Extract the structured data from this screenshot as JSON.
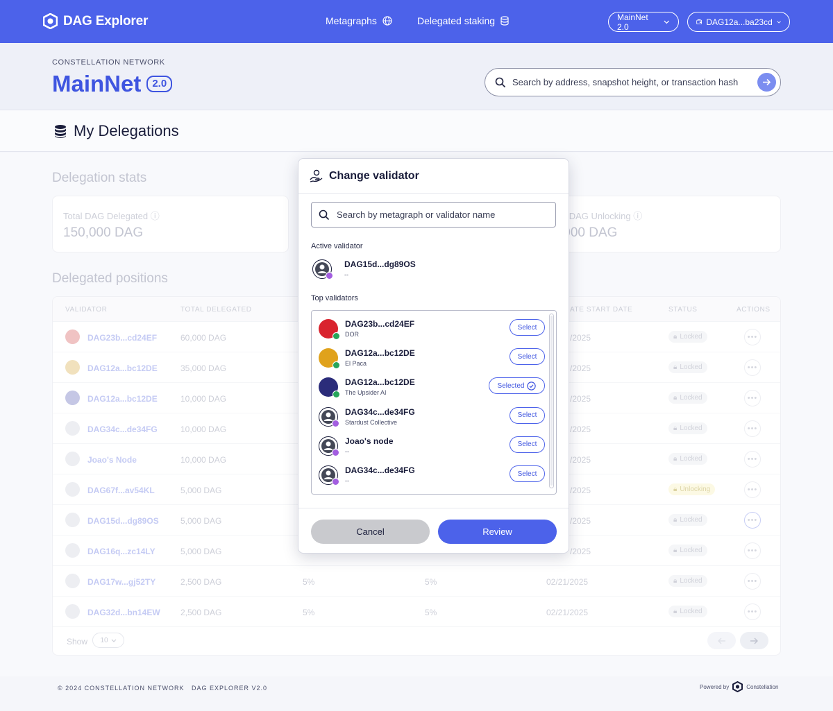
{
  "topbar": {
    "logo_text": "DAG Explorer",
    "nav": [
      {
        "label": "Metagraphs",
        "icon": "globe-icon"
      },
      {
        "label": "Delegated staking",
        "icon": "database-icon"
      }
    ],
    "network_label": "MainNet 2.0",
    "wallet_label": "DAG12a...ba23cd"
  },
  "hero": {
    "eyebrow": "CONSTELLATION NETWORK",
    "title": "MainNet",
    "badge": "2.0",
    "search_placeholder": "Search by address, snapshot height, or transaction hash"
  },
  "page_title": "My Delegations",
  "stats": {
    "heading": "Delegation stats",
    "cards": [
      {
        "label": "Total DAG Delegated",
        "value": "150,000 DAG"
      },
      {
        "label": "al DAG Unlocking",
        "value": ",000 DAG"
      }
    ]
  },
  "positions": {
    "heading": "Delegated positions",
    "columns": [
      "VALIDATOR",
      "TOTAL DELEGATED",
      "ATE START DATE",
      "STATUS",
      "ACTIONS"
    ],
    "rows": [
      {
        "validator": "DAG23b...cd24EF",
        "total": "60,000 DAG",
        "c3": "",
        "c4": "",
        "date": "/2025",
        "status": "Locked",
        "avatar": "#e8a3a3"
      },
      {
        "validator": "DAG12a...bc12DE",
        "total": "35,000 DAG",
        "c3": "",
        "c4": "",
        "date": "/2025",
        "status": "Locked",
        "avatar": "#ead29a"
      },
      {
        "validator": "DAG12a...bc12DE",
        "total": "10,000 DAG",
        "c3": "",
        "c4": "",
        "date": "/2025",
        "status": "Locked",
        "avatar": "#a7a9d8"
      },
      {
        "validator": "DAG34c...de34FG",
        "total": "10,000 DAG",
        "c3": "",
        "c4": "",
        "date": "/2025",
        "status": "Locked",
        "avatar": "#e3e5ec"
      },
      {
        "validator": "Joao's Node",
        "total": "10,000 DAG",
        "c3": "",
        "c4": "",
        "date": "/2025",
        "status": "Locked",
        "avatar": "#e3e5ec"
      },
      {
        "validator": "DAG67f...av54KL",
        "total": "5,000 DAG",
        "c3": "",
        "c4": "",
        "date": "/2025",
        "status": "Unlocking",
        "avatar": "#e3e5ec"
      },
      {
        "validator": "DAG15d...dg89OS",
        "total": "5,000 DAG",
        "c3": "",
        "c4": "",
        "date": "/2025",
        "status": "Locked",
        "avatar": "#e3e5ec"
      },
      {
        "validator": "DAG16q...zc14LY",
        "total": "5,000 DAG",
        "c3": "",
        "c4": "",
        "date": "/2025",
        "status": "Locked",
        "avatar": "#e3e5ec"
      },
      {
        "validator": "DAG17w...gj52TY",
        "total": "2,500 DAG",
        "c3": "5%",
        "c4": "5%",
        "date": "02/21/2025",
        "status": "Locked",
        "avatar": "#e3e5ec"
      },
      {
        "validator": "DAG32d...bn14EW",
        "total": "2,500 DAG",
        "c3": "5%",
        "c4": "5%",
        "date": "02/21/2025",
        "status": "Locked",
        "avatar": "#e3e5ec"
      }
    ],
    "show_label": "Show",
    "page_size": "10"
  },
  "modal": {
    "title": "Change validator",
    "search_placeholder": "Search by metagraph or validator name",
    "active_label": "Active validator",
    "active": {
      "name": "DAG15d...dg89OS",
      "sub": "--"
    },
    "top_label": "Top validators",
    "validators": [
      {
        "name": "DAG23b...cd24EF",
        "sub": "DOR",
        "button": "Select",
        "selected": false,
        "avatar": "#d9232e"
      },
      {
        "name": "DAG12a...bc12DE",
        "sub": "El Paca",
        "button": "Select",
        "selected": false,
        "avatar": "#e0a21c"
      },
      {
        "name": "DAG12a...bc12DE",
        "sub": "The Upsider AI",
        "button": "Selected",
        "selected": true,
        "avatar": "#2b2c7a"
      },
      {
        "name": "DAG34c...de34FG",
        "sub": "Stardust Collective",
        "button": "Select",
        "selected": false,
        "avatar": "#ffffff"
      },
      {
        "name": "Joao's node",
        "sub": "--",
        "button": "Select",
        "selected": false,
        "avatar": "#ffffff"
      },
      {
        "name": "DAG34c...de34FG",
        "sub": "--",
        "button": "Select",
        "selected": false,
        "avatar": "#ffffff"
      }
    ],
    "cancel_label": "Cancel",
    "review_label": "Review"
  },
  "footer": {
    "copyright": "© 2024 CONSTELLATION NETWORK",
    "version": "DAG EXPLORER V2.0",
    "powered_by": "Powered by",
    "brand": "Constellation"
  },
  "colors": {
    "brand": "#4c62ea",
    "unlocking": "#fbf6d6"
  }
}
